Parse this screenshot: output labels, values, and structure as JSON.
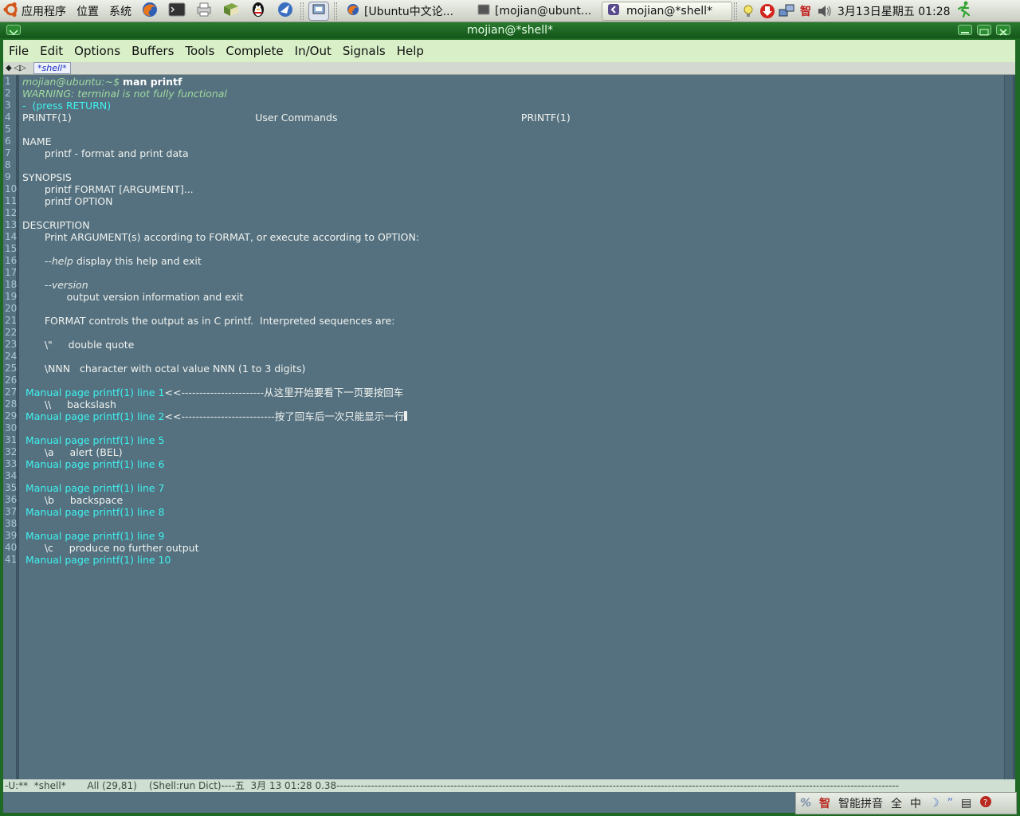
{
  "panel": {
    "menus": [
      {
        "label": "应用程序",
        "icon": "ubuntu-logo-icon"
      },
      {
        "label": "位置"
      },
      {
        "label": "系统"
      }
    ],
    "launchers": [
      "firefox-icon",
      "terminal-icon",
      "printer-icon",
      "book-icon",
      "qq-penguin-icon",
      "pidgin-icon",
      "screen-capture-icon"
    ],
    "tasks": [
      {
        "label": "[Ubuntu中文论...",
        "icon": "firefox-icon",
        "active": false
      },
      {
        "label": "[mojian@ubunt...",
        "icon": "terminal-icon",
        "active": false
      },
      {
        "label": "mojian@*shell*",
        "icon": "emacs-icon",
        "active": true
      }
    ],
    "tray_icons": [
      "lightbulb-icon",
      "update-arrow-icon",
      "network-icon",
      "ime-icon",
      "volume-icon"
    ],
    "clock": "3月13日星期五 01:28"
  },
  "window": {
    "title": "mojian@*shell*"
  },
  "menubar": [
    "File",
    "Edit",
    "Options",
    "Buffers",
    "Tools",
    "Complete",
    "In/Out",
    "Signals",
    "Help"
  ],
  "tabbar": {
    "tab_label": "*shell*"
  },
  "buffer": {
    "lines": [
      {
        "n": "1",
        "segs": [
          {
            "t": "mojian@ubuntu:~$ ",
            "c": "prompt"
          },
          {
            "t": "man printf",
            "c": "cmd"
          }
        ]
      },
      {
        "n": "2",
        "segs": [
          {
            "t": "WARNING: terminal is not fully functional",
            "c": "warn"
          }
        ]
      },
      {
        "n": "3",
        "segs": [
          {
            "t": "-  (press RETURN)",
            "c": "cyan"
          }
        ]
      },
      {
        "n": "4",
        "segs": [
          {
            "t": "PRINTF(1)                                                          User Commands                                                          PRINTF(1)",
            "c": ""
          }
        ]
      },
      {
        "n": "5",
        "segs": []
      },
      {
        "n": "6",
        "segs": [
          {
            "t": "NAME",
            "c": ""
          }
        ]
      },
      {
        "n": "7",
        "segs": [
          {
            "t": "       printf - format and print data",
            "c": ""
          }
        ]
      },
      {
        "n": "8",
        "segs": []
      },
      {
        "n": "9",
        "segs": [
          {
            "t": "SYNOPSIS",
            "c": ""
          }
        ]
      },
      {
        "n": "10",
        "segs": [
          {
            "t": "       printf FORMAT [ARGUMENT]...",
            "c": ""
          }
        ]
      },
      {
        "n": "11",
        "segs": [
          {
            "t": "       printf OPTION",
            "c": ""
          }
        ]
      },
      {
        "n": "12",
        "segs": []
      },
      {
        "n": "13",
        "segs": [
          {
            "t": "DESCRIPTION",
            "c": ""
          }
        ]
      },
      {
        "n": "14",
        "segs": [
          {
            "t": "       Print ARGUMENT(s) according to FORMAT, or execute according to OPTION:",
            "c": ""
          }
        ]
      },
      {
        "n": "15",
        "segs": []
      },
      {
        "n": "16",
        "segs": [
          {
            "t": "       ",
            "c": ""
          },
          {
            "t": "--help",
            "c": "ital"
          },
          {
            "t": " display this help and exit",
            "c": ""
          }
        ]
      },
      {
        "n": "17",
        "segs": []
      },
      {
        "n": "18",
        "segs": [
          {
            "t": "       ",
            "c": ""
          },
          {
            "t": "--version",
            "c": "ital"
          }
        ]
      },
      {
        "n": "19",
        "segs": [
          {
            "t": "              output version information and exit",
            "c": ""
          }
        ]
      },
      {
        "n": "20",
        "segs": []
      },
      {
        "n": "21",
        "segs": [
          {
            "t": "       FORMAT controls the output as in C printf.  Interpreted sequences are:",
            "c": ""
          }
        ]
      },
      {
        "n": "22",
        "segs": []
      },
      {
        "n": "23",
        "segs": [
          {
            "t": "       \\\"     double quote",
            "c": ""
          }
        ]
      },
      {
        "n": "24",
        "segs": []
      },
      {
        "n": "25",
        "segs": [
          {
            "t": "       \\NNN   character with octal value NNN (1 to 3 digits)",
            "c": ""
          }
        ]
      },
      {
        "n": "26",
        "segs": []
      },
      {
        "n": "27",
        "segs": [
          {
            "t": " Manual page printf(1) line 1",
            "c": "cyan"
          },
          {
            "t": "<<-----------------------从这里开始要看下一页要按回车",
            "c": ""
          }
        ]
      },
      {
        "n": "28",
        "segs": [
          {
            "t": "       \\\\     backslash",
            "c": ""
          }
        ]
      },
      {
        "n": "29",
        "segs": [
          {
            "t": " Manual page printf(1) line 2",
            "c": "cyan"
          },
          {
            "t": "<<--------------------------按了回车后一次只能显示一行",
            "c": ""
          }
        ],
        "cursor": true
      },
      {
        "n": "30",
        "segs": []
      },
      {
        "n": "31",
        "segs": [
          {
            "t": " Manual page printf(1) line 5",
            "c": "cyan"
          }
        ]
      },
      {
        "n": "32",
        "segs": [
          {
            "t": "       \\a     alert (BEL)",
            "c": ""
          }
        ]
      },
      {
        "n": "33",
        "segs": [
          {
            "t": " Manual page printf(1) line 6",
            "c": "cyan"
          }
        ]
      },
      {
        "n": "34",
        "segs": []
      },
      {
        "n": "35",
        "segs": [
          {
            "t": " Manual page printf(1) line 7",
            "c": "cyan"
          }
        ]
      },
      {
        "n": "36",
        "segs": [
          {
            "t": "       \\b     backspace",
            "c": ""
          }
        ]
      },
      {
        "n": "37",
        "segs": [
          {
            "t": " Manual page printf(1) line 8",
            "c": "cyan"
          }
        ]
      },
      {
        "n": "38",
        "segs": []
      },
      {
        "n": "39",
        "segs": [
          {
            "t": " Manual page printf(1) line 9",
            "c": "cyan"
          }
        ]
      },
      {
        "n": "40",
        "segs": [
          {
            "t": "       \\c     produce no further output",
            "c": ""
          }
        ]
      },
      {
        "n": "41",
        "segs": [
          {
            "t": " Manual page printf(1) line 10",
            "c": "cyan"
          }
        ]
      }
    ]
  },
  "modeline": {
    "text": "-U:**  *shell*       All (29,81)    (Shell:run Dict)----五  3月 13 01:28 0.38-------------------------------------------------------------------------------------------------------------------------------------------------------------------"
  },
  "ime": {
    "items": [
      "智能拼音",
      "全",
      "中"
    ],
    "icons": [
      "ime-logo-icon",
      "ime-mode-icon",
      "moon-icon",
      "quote-icon",
      "keyboard-icon",
      "help-icon"
    ]
  },
  "colors": {
    "editor_bg": "#55707f",
    "menubar_bg": "#d8efc8",
    "titlebar_bg": "#1e6a24",
    "link_cyan": "#3ef2ef"
  }
}
